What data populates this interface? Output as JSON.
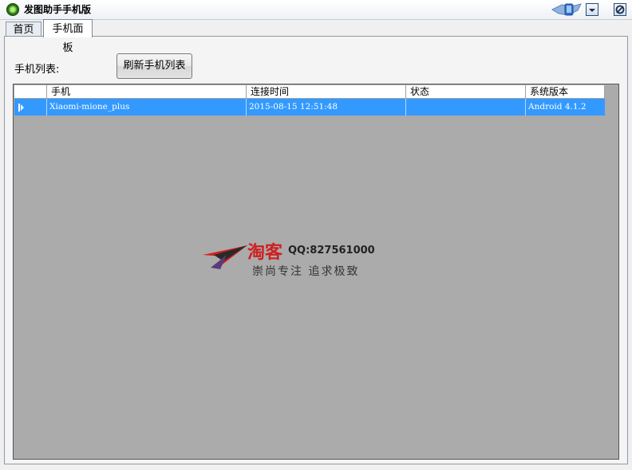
{
  "window": {
    "title": "发图助手手机版",
    "controls": {
      "minimize_icon": "chevron-down-icon",
      "close_icon": "close-icon",
      "skin_icon": "skin-icon"
    }
  },
  "tabs": [
    {
      "label": "首页",
      "active": false
    },
    {
      "label": "手机面板",
      "active": true
    }
  ],
  "phone_panel": {
    "list_label": "手机列表:",
    "refresh_button": "刷新手机列表"
  },
  "grid": {
    "columns": [
      "手机",
      "连接时间",
      "状态",
      "系统版本"
    ],
    "rows": [
      {
        "phone": "Xiaomi-mione_plus",
        "connected_at": "2015-08-15 12:51:48",
        "status": "",
        "os_version": "Android 4.1.2",
        "selected": true
      }
    ]
  },
  "watermark": {
    "brand": "淘客",
    "qq": "QQ:827561000",
    "slogan": "崇尚专注 追求极致"
  },
  "colors": {
    "selection": "#3399ff",
    "grid_background": "#ababab",
    "watermark_red": "#cf1f1f"
  }
}
